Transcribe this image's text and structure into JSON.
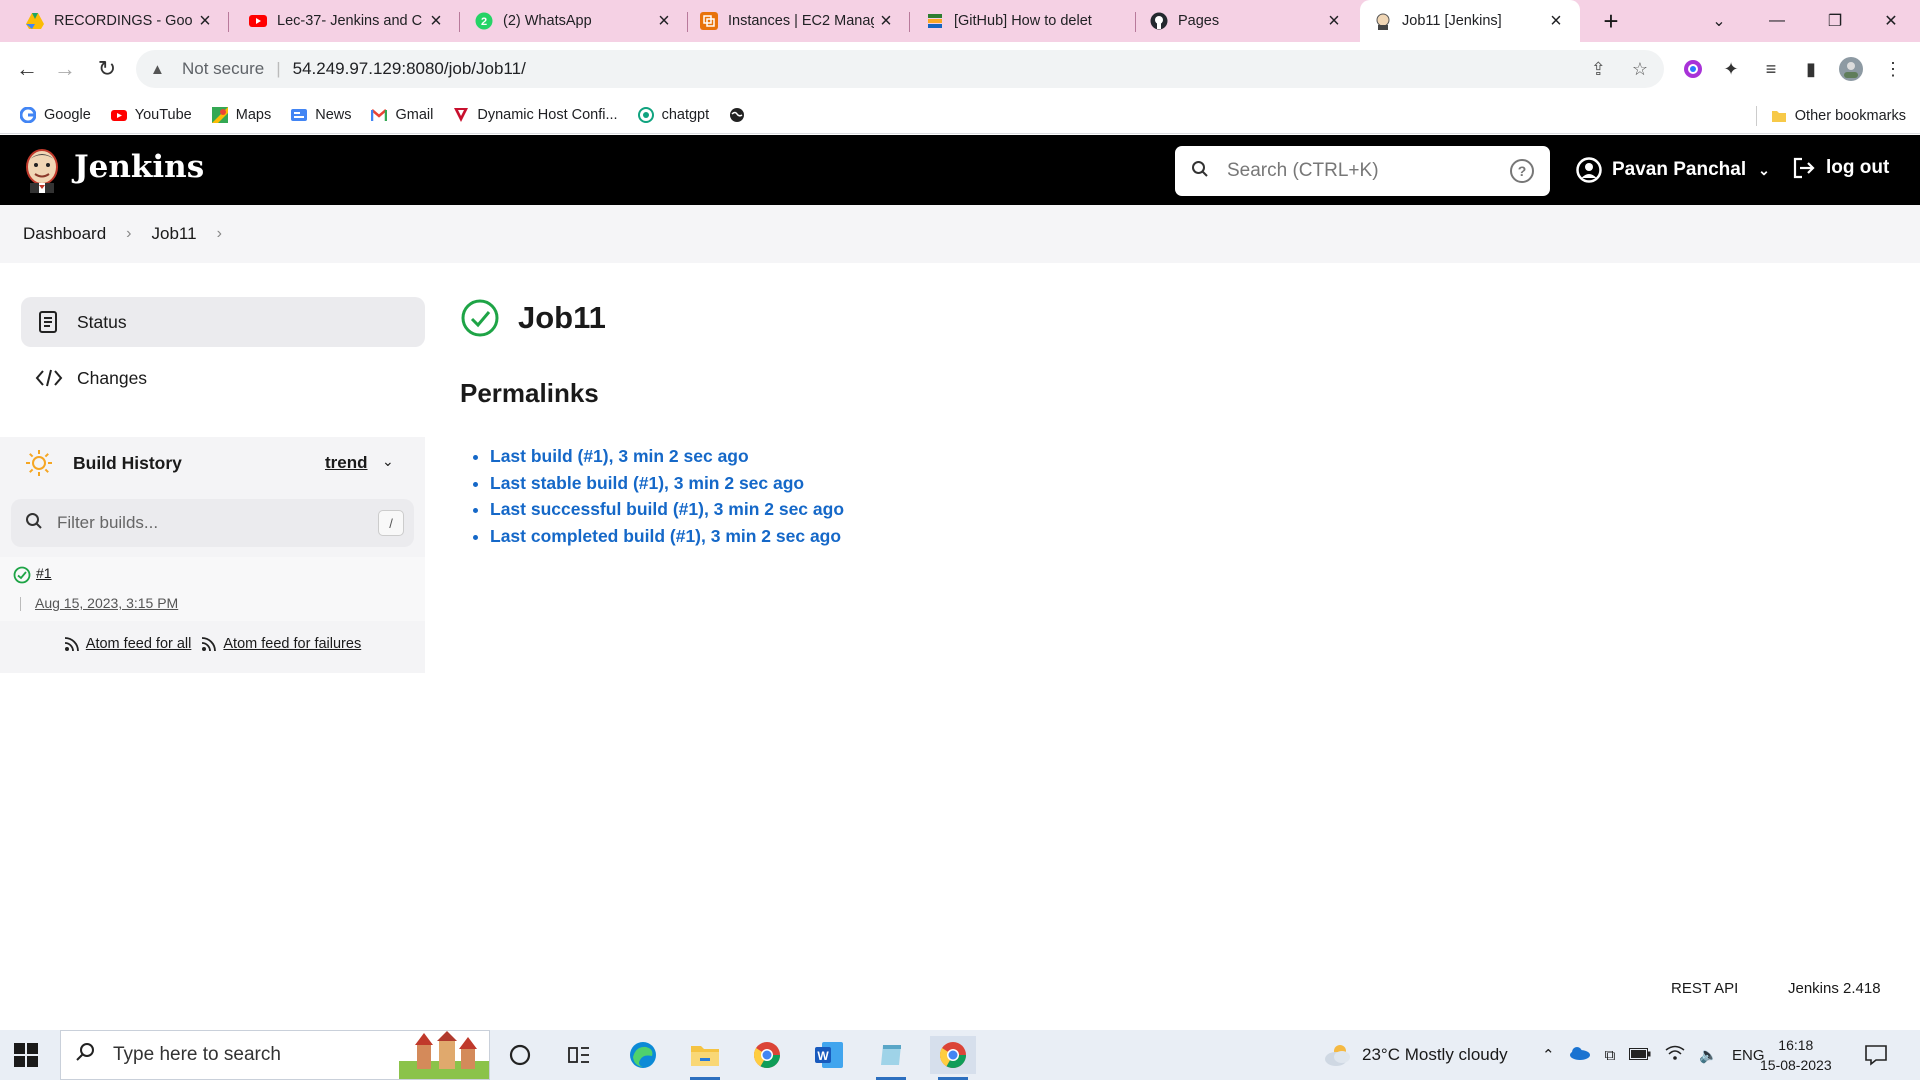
{
  "browser": {
    "tabs": [
      {
        "title": "RECORDINGS - Googl",
        "icon": "google-drive-icon"
      },
      {
        "title": "Lec-37- Jenkins and C",
        "icon": "youtube-icon"
      },
      {
        "title": "(2) WhatsApp",
        "icon": "whatsapp-icon"
      },
      {
        "title": "Instances | EC2 Manag",
        "icon": "aws-icon"
      },
      {
        "title": "[GitHub] How to delet",
        "icon": "stack-icon"
      },
      {
        "title": "Pages",
        "icon": "github-icon"
      },
      {
        "title": "Job11 [Jenkins]",
        "icon": "jenkins-icon"
      }
    ],
    "security_label": "Not secure",
    "url": "54.249.97.129:8080/job/Job11/",
    "bookmarks": [
      {
        "label": "Google",
        "icon": "google-icon"
      },
      {
        "label": "YouTube",
        "icon": "youtube-icon"
      },
      {
        "label": "Maps",
        "icon": "maps-icon"
      },
      {
        "label": "News",
        "icon": "news-icon"
      },
      {
        "label": "Gmail",
        "icon": "gmail-icon"
      },
      {
        "label": "Dynamic Host Confi...",
        "icon": "dhcp-icon"
      },
      {
        "label": "chatgpt",
        "icon": "chatgpt-icon"
      }
    ],
    "other_bookmarks": "Other bookmarks"
  },
  "jenkins": {
    "brand": "Jenkins",
    "search_placeholder": "Search (CTRL+K)",
    "user": "Pavan Panchal",
    "logout": "log out",
    "breadcrumb": [
      "Dashboard",
      "Job11"
    ],
    "side": {
      "status": "Status",
      "changes": "Changes"
    },
    "build_history": {
      "title": "Build History",
      "trend": "trend",
      "filter_placeholder": "Filter builds...",
      "filter_shortcut": "/",
      "builds": [
        {
          "number": "#1",
          "date": "Aug 15, 2023, 3:15 PM"
        }
      ],
      "feed_all": "Atom feed for all",
      "feed_failures": "Atom feed for failures"
    },
    "job_title": "Job11",
    "permalinks_heading": "Permalinks",
    "permalinks": [
      "Last build (#1), 3 min 2 sec ago",
      "Last stable build (#1), 3 min 2 sec ago",
      "Last successful build (#1), 3 min 2 sec ago",
      "Last completed build (#1), 3 min 2 sec ago"
    ],
    "footer": {
      "rest_api": "REST API",
      "version": "Jenkins 2.418"
    }
  },
  "taskbar": {
    "search_placeholder": "Type here to search",
    "weather": "23°C  Mostly cloudy",
    "language": "ENG",
    "time": "16:18",
    "date": "15-08-2023"
  },
  "colors": {
    "tabstrip": "#f5d1e4",
    "jenkins_header": "#000000",
    "link": "#1568c8",
    "success": "#1ea446"
  }
}
